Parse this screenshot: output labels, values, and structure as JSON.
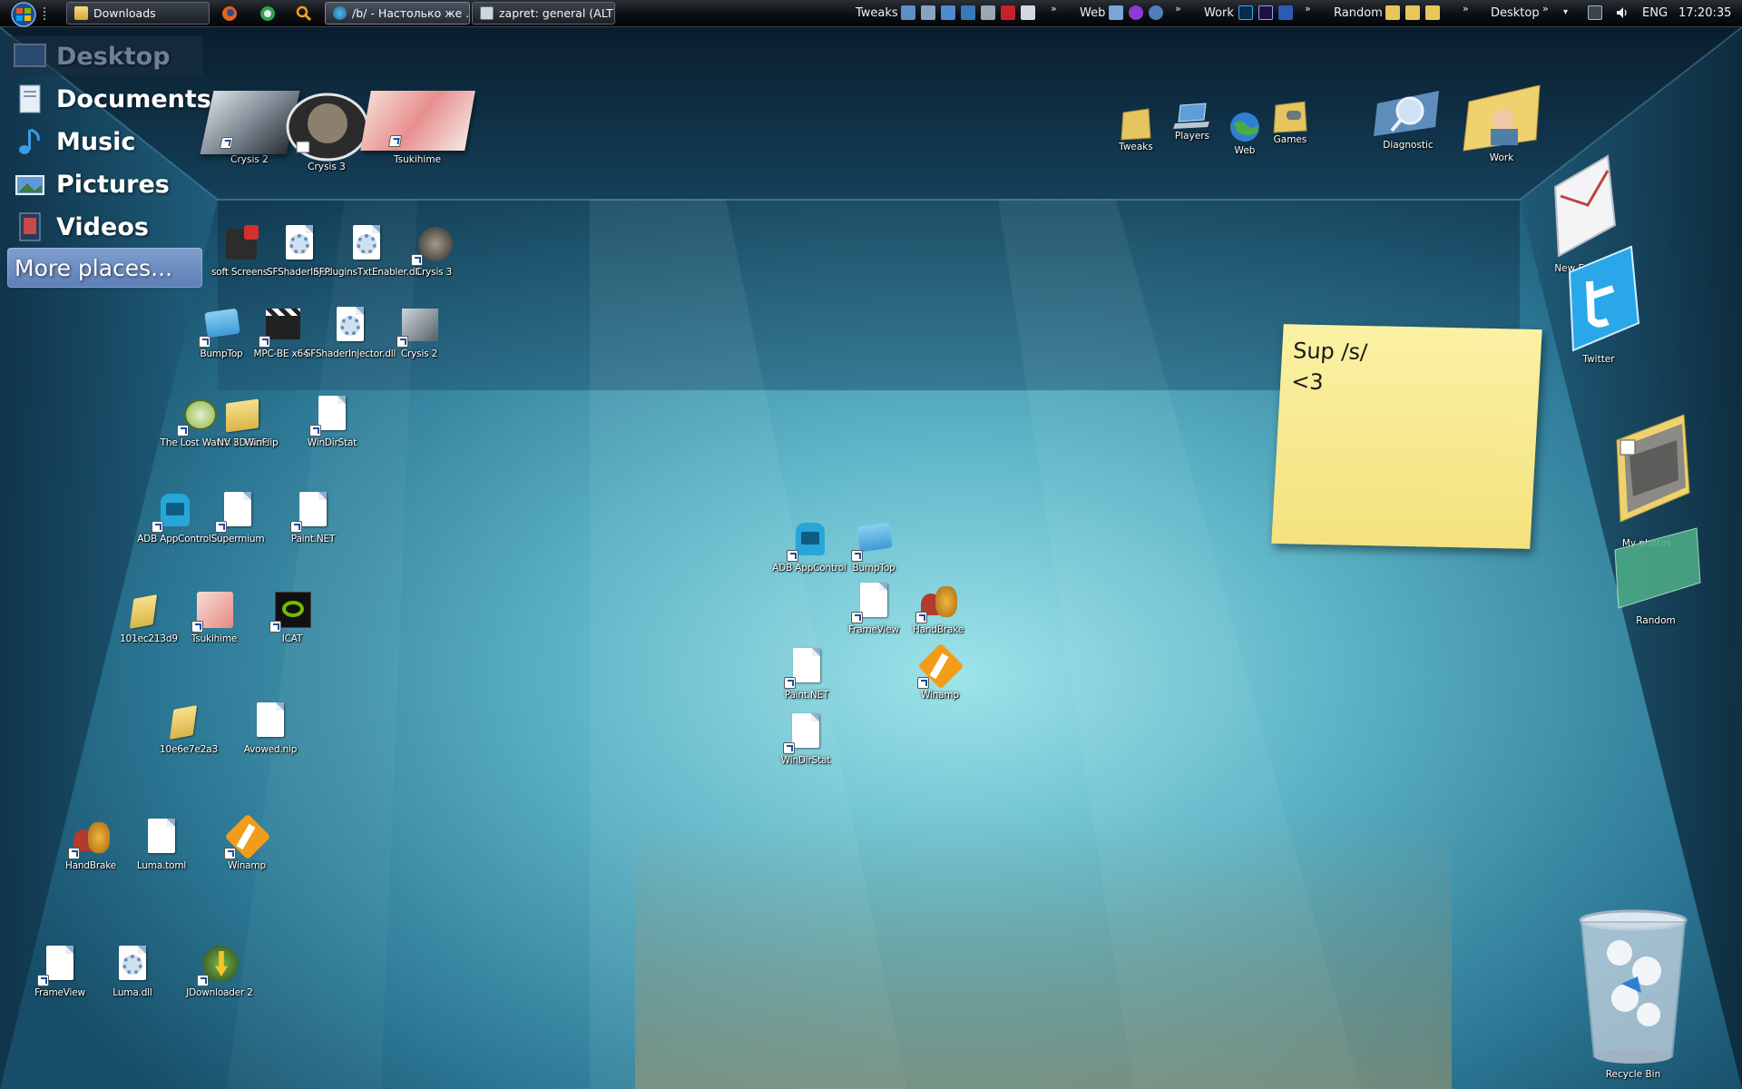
{
  "taskbar": {
    "tasks": [
      {
        "label": "Downloads"
      },
      {
        "label": "/b/ - Настолько же ..."
      },
      {
        "label": "zapret: general (ALT)"
      }
    ],
    "groups": [
      {
        "label": "Tweaks"
      },
      {
        "label": "Web"
      },
      {
        "label": "Work"
      },
      {
        "label": "Random"
      },
      {
        "label": "Desktop"
      }
    ],
    "overflow": "»",
    "language": "ENG",
    "clock": "17:20:35"
  },
  "places": {
    "items": [
      {
        "label": "Desktop"
      },
      {
        "label": "Documents"
      },
      {
        "label": "Music"
      },
      {
        "label": "Pictures"
      },
      {
        "label": "Videos"
      }
    ],
    "more": "More places..."
  },
  "pinned_top": [
    {
      "label": "Crysis 2"
    },
    {
      "label": "Crysis 3"
    },
    {
      "label": "Tsukihime"
    }
  ],
  "back_wall": [
    {
      "label": "Tweaks"
    },
    {
      "label": "Players"
    },
    {
      "label": "Web"
    },
    {
      "label": "Games"
    },
    {
      "label": "Diagnostic"
    },
    {
      "label": "Work"
    }
  ],
  "right_wall": [
    {
      "label": "New Email"
    },
    {
      "label": "Twitter"
    },
    {
      "label": "My photos"
    },
    {
      "label": "Random"
    }
  ],
  "sticky_note": {
    "line1": "Sup /s/",
    "line2": "<3"
  },
  "left_icons": [
    {
      "label": "soft Screens"
    },
    {
      "label": "SFShaderInjec"
    },
    {
      "label": "SFPluginsTxtEnabler.dll"
    },
    {
      "label": "Crysis 3"
    },
    {
      "label": "BumpTop"
    },
    {
      "label": "MPC-BE x64"
    },
    {
      "label": "SFShaderInjector.dll"
    },
    {
      "label": "Crysis 2"
    },
    {
      "label": "The Lost Watch II"
    },
    {
      "label": "NV 3D Scre"
    },
    {
      "label": "WinFlip"
    },
    {
      "label": "WinDirStat"
    },
    {
      "label": "ADB AppControl"
    },
    {
      "label": "Supermium"
    },
    {
      "label": "Paint.NET"
    },
    {
      "label": "101ec213d9"
    },
    {
      "label": "Tsukihime"
    },
    {
      "label": "ICAT"
    },
    {
      "label": "10e6e7e2a3"
    },
    {
      "label": "Avowed.nip"
    },
    {
      "label": "HandBrake"
    },
    {
      "label": "Luma.toml"
    },
    {
      "label": "Winamp"
    },
    {
      "label": "FrameView"
    },
    {
      "label": "Luma.dll"
    },
    {
      "label": "JDownloader 2"
    }
  ],
  "center_icons": [
    {
      "label": "ADB AppControl"
    },
    {
      "label": "BumpTop"
    },
    {
      "label": "FrameView"
    },
    {
      "label": "HandBrake"
    },
    {
      "label": "Paint.NET"
    },
    {
      "label": "Winamp"
    },
    {
      "label": "WinDirStat"
    }
  ],
  "recycle_bin": {
    "label": "Recycle Bin"
  },
  "colors": {
    "wall": "#2f6d8c",
    "floor_glow": "#8fdbe3",
    "taskbar": "#0c0f13",
    "sticky": "#f7e98f",
    "places_highlight": "#6f8fc6"
  }
}
